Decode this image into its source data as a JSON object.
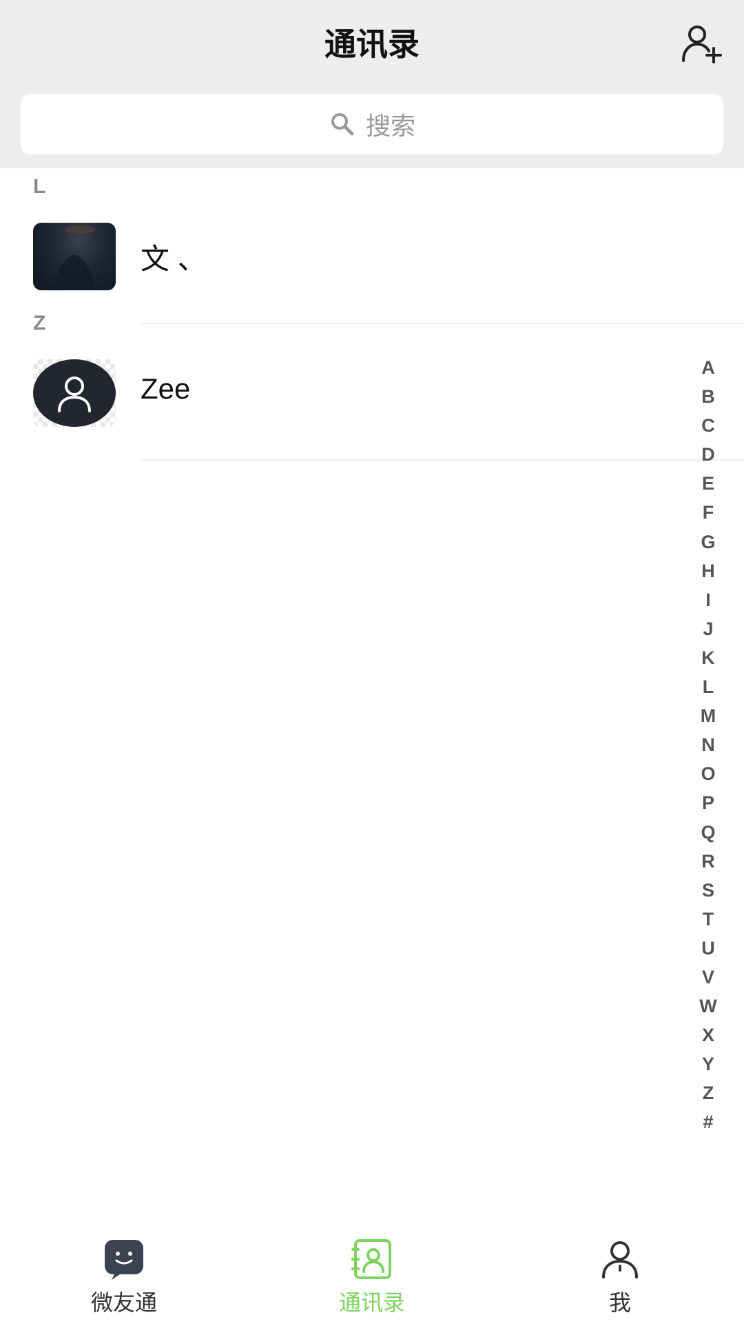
{
  "header": {
    "title": "通讯录",
    "add_icon": "add-contact-icon"
  },
  "search": {
    "placeholder": "搜索",
    "icon": "search-icon"
  },
  "sections": [
    {
      "letter": "L",
      "contacts": [
        {
          "name": "文   、",
          "avatar": "photo"
        }
      ]
    },
    {
      "letter": "Z",
      "contacts": [
        {
          "name": "Zee",
          "avatar": "default-user-icon"
        }
      ]
    }
  ],
  "index_letters": [
    "A",
    "B",
    "C",
    "D",
    "E",
    "F",
    "G",
    "H",
    "I",
    "J",
    "K",
    "L",
    "M",
    "N",
    "O",
    "P",
    "Q",
    "R",
    "S",
    "T",
    "U",
    "V",
    "W",
    "X",
    "Y",
    "Z",
    "#"
  ],
  "tabbar": {
    "tabs": [
      {
        "label": "微友通",
        "icon": "chat-bubble-icon",
        "active": false
      },
      {
        "label": "通讯录",
        "icon": "contacts-book-icon",
        "active": true
      },
      {
        "label": "我",
        "icon": "person-icon",
        "active": false
      }
    ],
    "active_color": "#7ed35f"
  }
}
